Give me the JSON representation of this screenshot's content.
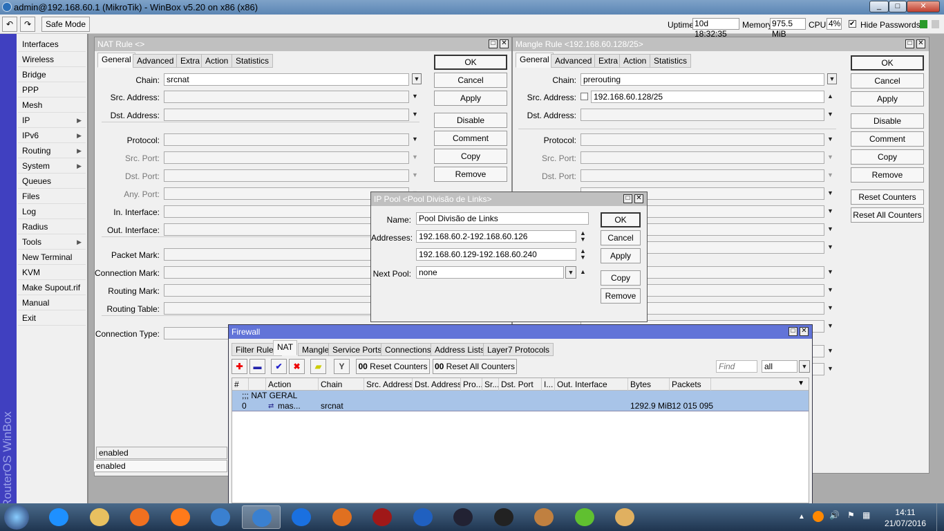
{
  "app": {
    "title": "admin@192.168.60.1 (MikroTik) - WinBox v5.20 on x86 (x86)"
  },
  "toolbar": {
    "undo": "↶",
    "redo": "↷",
    "safe_mode": "Safe Mode",
    "uptime_label": "Uptime:",
    "uptime": "10d 18:32:35",
    "memory_label": "Memory:",
    "memory": "975.5 MiB",
    "cpu_label": "CPU:",
    "cpu": "4%",
    "hide_passwords": "Hide Passwords",
    "hide_passwords_checked": true
  },
  "sidebar": {
    "brand": "RouterOS WinBox",
    "items": [
      {
        "label": "Interfaces"
      },
      {
        "label": "Wireless"
      },
      {
        "label": "Bridge"
      },
      {
        "label": "PPP"
      },
      {
        "label": "Mesh"
      },
      {
        "label": "IP",
        "sub": true
      },
      {
        "label": "IPv6",
        "sub": true
      },
      {
        "label": "Routing",
        "sub": true
      },
      {
        "label": "System",
        "sub": true
      },
      {
        "label": "Queues"
      },
      {
        "label": "Files"
      },
      {
        "label": "Log"
      },
      {
        "label": "Radius"
      },
      {
        "label": "Tools",
        "sub": true
      },
      {
        "label": "New Terminal"
      },
      {
        "label": "KVM"
      },
      {
        "label": "Make Supout.rif"
      },
      {
        "label": "Manual"
      },
      {
        "label": "Exit"
      }
    ]
  },
  "nat_rule": {
    "title": "NAT Rule <>",
    "tabs": [
      "General",
      "Advanced",
      "Extra",
      "Action",
      "Statistics"
    ],
    "fields": [
      {
        "label": "Chain",
        "value": "srcnat"
      },
      {
        "label": "Src. Address",
        "value": ""
      },
      {
        "label": "Dst. Address",
        "value": ""
      },
      {
        "label": "Protocol",
        "value": ""
      },
      {
        "label": "Src. Port",
        "value": "",
        "disabled": true
      },
      {
        "label": "Dst. Port",
        "value": "",
        "disabled": true
      },
      {
        "label": "Any. Port",
        "value": "",
        "disabled": true
      },
      {
        "label": "In. Interface",
        "value": ""
      },
      {
        "label": "Out. Interface",
        "value": ""
      },
      {
        "label": "Packet Mark",
        "value": ""
      },
      {
        "label": "Connection Mark",
        "value": ""
      },
      {
        "label": "Routing Mark",
        "value": ""
      },
      {
        "label": "Routing Table",
        "value": ""
      },
      {
        "label": "Connection Type",
        "value": ""
      }
    ],
    "buttons": [
      "OK",
      "Cancel",
      "Apply",
      "Disable",
      "Comment",
      "Copy",
      "Remove"
    ],
    "status": "enabled",
    "status2": "enabled"
  },
  "mangle_rule": {
    "title": "Mangle Rule <192.168.60.128/25>",
    "tabs": [
      "General",
      "Advanced",
      "Extra",
      "Action",
      "Statistics"
    ],
    "fields": [
      {
        "label": "Chain",
        "value": "prerouting"
      },
      {
        "label": "Src. Address",
        "value": "192.168.60.128/25"
      },
      {
        "label": "Dst. Address",
        "value": ""
      },
      {
        "label": "Protocol",
        "value": ""
      },
      {
        "label": "Src. Port",
        "value": "",
        "disabled": true
      },
      {
        "label": "Dst. Port",
        "value": "",
        "disabled": true
      }
    ],
    "buttons": [
      "OK",
      "Cancel",
      "Apply",
      "Disable",
      "Comment",
      "Copy",
      "Remove",
      "Reset Counters",
      "Reset All Counters"
    ]
  },
  "ip_pool": {
    "title": "IP Pool <Pool Divisão de Links>",
    "name_label": "Name:",
    "name": "Pool Divisão de Links",
    "addresses_label": "Addresses:",
    "addresses": [
      "192.168.60.2-192.168.60.126",
      "192.168.60.129-192.168.60.240"
    ],
    "next_pool_label": "Next Pool:",
    "next_pool": "none",
    "buttons": [
      "OK",
      "Cancel",
      "Apply",
      "Copy",
      "Remove"
    ]
  },
  "firewall": {
    "title": "Firewall",
    "tabs": [
      "Filter Rules",
      "NAT",
      "Mangle",
      "Service Ports",
      "Connections",
      "Address Lists",
      "Layer7 Protocols"
    ],
    "active_tab": "NAT",
    "reset_counters": "Reset Counters",
    "reset_all_counters": "Reset All Counters",
    "find_placeholder": "Find",
    "filter": "all",
    "columns": [
      "#",
      "",
      "Action",
      "Chain",
      "Src. Address",
      "Dst. Address",
      "Pro...",
      "Sr...",
      "Dst. Port",
      "I...",
      "Out. Interface",
      "Bytes",
      "Packets"
    ],
    "comment": ";;; NAT GERAL",
    "rows": [
      {
        "num": "0",
        "action": "mas...",
        "chain": "srcnat",
        "bytes": "1292.9 MiB",
        "packets": "12 015 095"
      }
    ]
  },
  "taskbar": {
    "apps": [
      "internet-explorer",
      "file-explorer",
      "media-player",
      "firefox",
      "winbox",
      "winbox-active",
      "teamviewer",
      "app-hand",
      "acrobat",
      "google-earth",
      "steam",
      "game-black-ops",
      "game-character",
      "vegas",
      "paint"
    ],
    "time": "14:11",
    "date": "21/07/2016"
  },
  "colors": {
    "selection": "#a8c4e8",
    "active_title": "#6274d8",
    "sidebar_bar": "#4040c0"
  }
}
